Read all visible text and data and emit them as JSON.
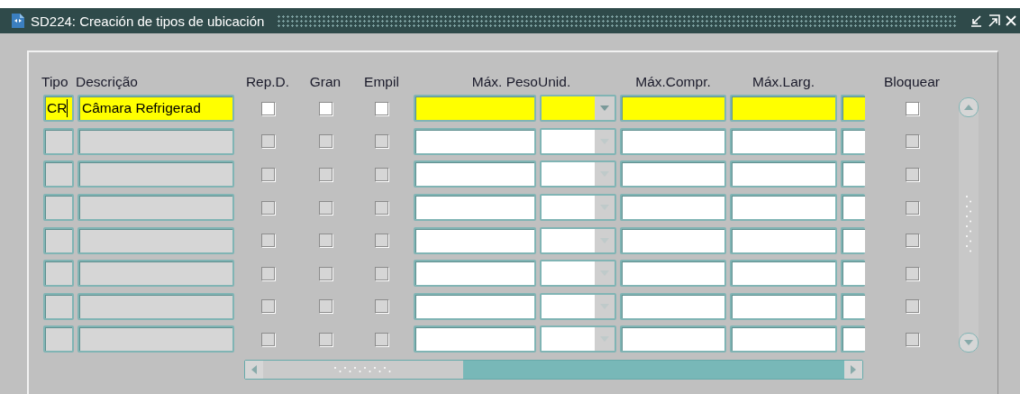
{
  "window": {
    "title": "SD224: Creación de tipos de ubicación"
  },
  "headers": [
    "Tipo",
    "Descrição",
    "Rep.D.",
    "Gran",
    "Empil",
    "Máx. Peso",
    "Unid.",
    "Máx.Compr.",
    "Máx.Larg.",
    "Bloquear"
  ],
  "rows": [
    {
      "selected": true,
      "tipo": "CR",
      "descricao": "Câmara Refrigerad",
      "rep_d": false,
      "gran": false,
      "empil": false,
      "bloquear": false
    },
    {
      "selected": false,
      "rep_d": false,
      "gran": false,
      "empil": false,
      "bloquear": false
    },
    {
      "selected": false,
      "rep_d": false,
      "gran": false,
      "empil": false,
      "bloquear": false
    },
    {
      "selected": false,
      "rep_d": false,
      "gran": false,
      "empil": false,
      "bloquear": false
    },
    {
      "selected": false,
      "rep_d": false,
      "gran": false,
      "empil": false,
      "bloquear": false
    },
    {
      "selected": false,
      "rep_d": false,
      "gran": false,
      "empil": false,
      "bloquear": false
    },
    {
      "selected": false,
      "rep_d": false,
      "gran": false,
      "empil": false,
      "bloquear": false
    },
    {
      "selected": false,
      "rep_d": false,
      "gran": false,
      "empil": false,
      "bloquear": false
    }
  ]
}
